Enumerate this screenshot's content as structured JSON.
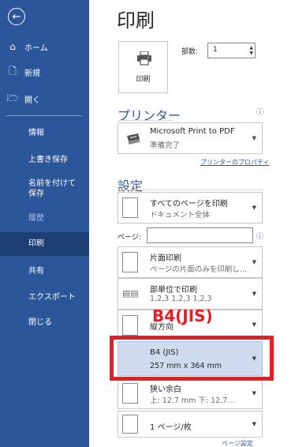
{
  "sidebar": {
    "back_icon": "back-arrow-icon",
    "items": [
      {
        "icon": "⌂",
        "label": "ホーム"
      },
      {
        "icon": "🗋",
        "label": "新規"
      },
      {
        "icon": "🗁",
        "label": "開く"
      }
    ],
    "sub_items": [
      "情報",
      "上書き保存",
      "名前を付けて保存",
      "履歴",
      "印刷",
      "共有",
      "エクスポート",
      "閉じる"
    ]
  },
  "main": {
    "title": "印刷",
    "print_button": "印刷",
    "copies_label": "部数:",
    "copies_value": "1",
    "printer_section": "プリンター",
    "printer_name": "Microsoft Print to PDF",
    "printer_status": "準備完了",
    "printer_properties": "プリンターのプロパティ",
    "settings_section": "設定",
    "settings": [
      {
        "t1": "すべてのページを印刷",
        "t2": "ドキュメント全体"
      },
      {
        "t1": "片面印刷",
        "t2": "ページの片面のみを印刷し…"
      },
      {
        "t1": "部単位で印刷",
        "t2": "1,2,3    1,2,3    1,2,3"
      },
      {
        "t1": "縦方向",
        "t2": ""
      },
      {
        "t1": "B4 (JIS)",
        "t2": "257 mm x 364 mm"
      },
      {
        "t1": "狭い余白",
        "t2": "上: 12.7 mm 下: 12.7…"
      },
      {
        "t1": "1 ページ/枚",
        "t2": ""
      }
    ],
    "pages_label": "ページ:",
    "page_setup_link": "ページ設定"
  },
  "annotation": {
    "text": "B4(JIS)",
    "color": "#e81c23"
  },
  "colors": {
    "sidebar": "#2b579a",
    "selected": "#1e3f73",
    "accent": "#2b579a",
    "selected_setting": "#cfdcf0"
  }
}
